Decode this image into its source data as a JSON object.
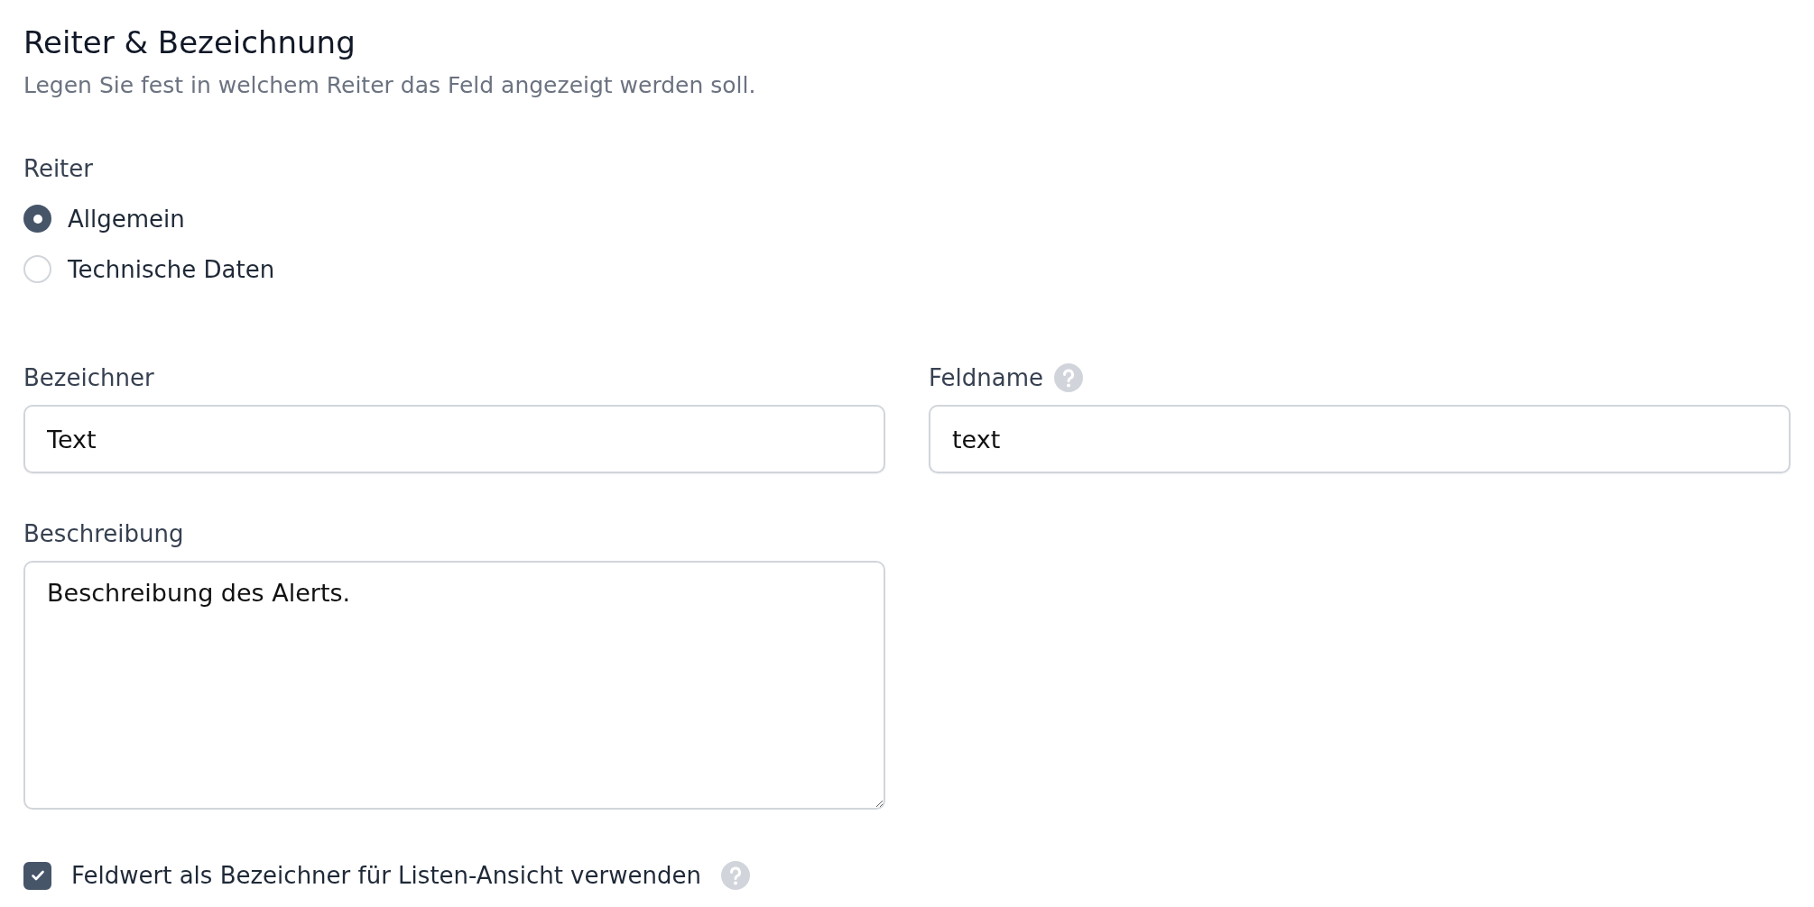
{
  "section": {
    "title": "Reiter & Bezeichnung",
    "description": "Legen Sie fest in welchem Reiter das Feld angezeigt werden soll."
  },
  "tab_group": {
    "label": "Reiter",
    "options": [
      {
        "label": "Allgemein",
        "selected": true
      },
      {
        "label": "Technische Daten",
        "selected": false
      }
    ]
  },
  "fields": [
    {
      "label": "Bezeichner",
      "value": "Text",
      "help": false
    },
    {
      "label": "Feldname",
      "value": "text",
      "help": true
    }
  ],
  "description_field": {
    "label": "Beschreibung",
    "value": "Beschreibung des Alerts."
  },
  "list_view_option": {
    "label": "Feldwert als Bezeichner für Listen-Ansicht verwenden",
    "checked": true,
    "help": true
  }
}
